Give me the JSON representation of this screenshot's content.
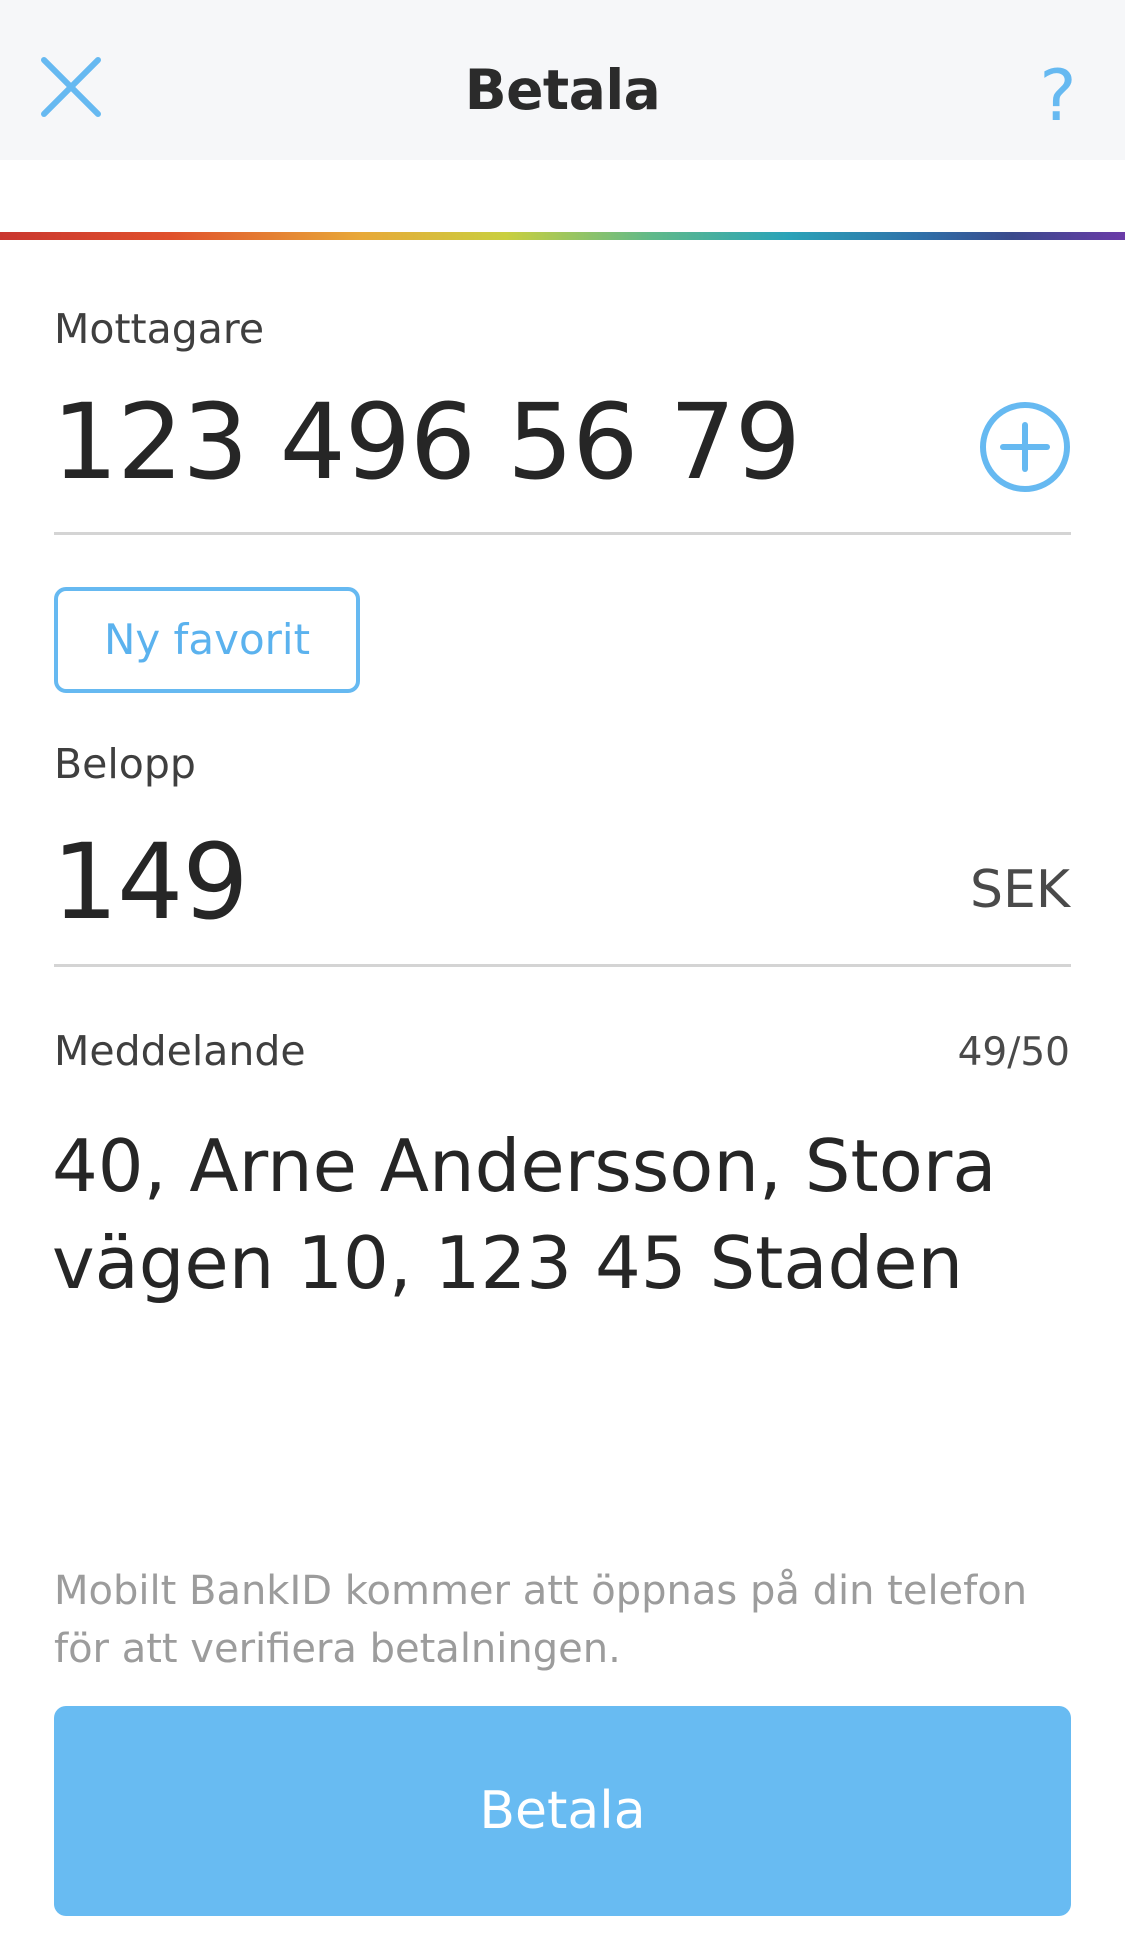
{
  "header": {
    "title": "Betala",
    "close_icon": "close-icon",
    "help_label": "?"
  },
  "colors": {
    "accent": "#66b9f1",
    "header_bg": "#f6f7f9",
    "button_bg": "#68bbf2",
    "muted_text": "#9c9c9c"
  },
  "recipient": {
    "label": "Mottagare",
    "value": "123 496 56 79",
    "add_icon": "plus-circle-icon"
  },
  "favorite_button": {
    "label": "Ny favorit"
  },
  "amount": {
    "label": "Belopp",
    "value": "149",
    "currency": "SEK"
  },
  "message": {
    "label": "Meddelande",
    "counter": "49/50",
    "value": "40, Arne Andersson, Stora vägen 10, 123 45 Staden"
  },
  "info": {
    "text": "Mobilt BankID kommer att öppnas på din telefon för att verifiera betalningen."
  },
  "pay_button": {
    "label": "Betala"
  }
}
